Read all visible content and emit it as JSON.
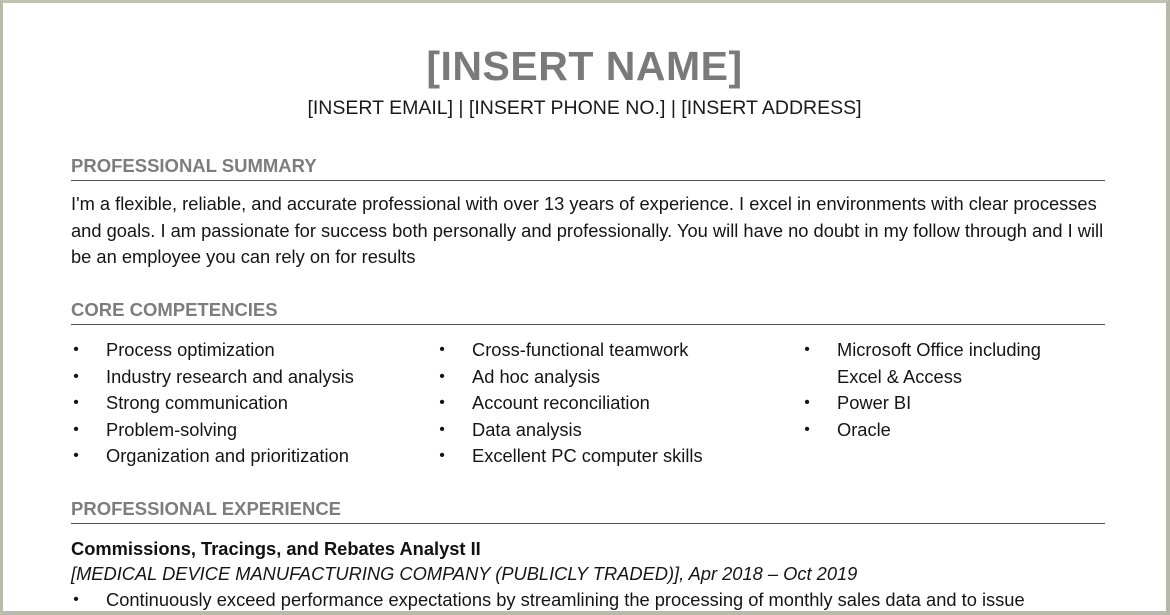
{
  "header": {
    "name": "[INSERT NAME]",
    "contact": "[INSERT EMAIL] | [INSERT PHONE NO.] | [INSERT ADDRESS]"
  },
  "colors": {
    "heading_gray": "#7d7d7d",
    "rule": "#555555",
    "body_text": "#151515",
    "frame": "#b8bcaa"
  },
  "summary": {
    "heading": "PROFESSIONAL SUMMARY",
    "text": "I'm a flexible, reliable, and accurate professional with over 13 years of experience. I excel in environments with clear processes and goals. I am passionate for success both personally and professionally. You will have no doubt in my follow through and I will be an employee you can rely on for results"
  },
  "competencies": {
    "heading": "CORE COMPETENCIES",
    "bullet_glyph": "•",
    "columns": [
      [
        "Process optimization",
        "Industry research and analysis",
        "Strong communication",
        "Problem-solving",
        "Organization and prioritization"
      ],
      [
        "Cross-functional teamwork",
        "Ad hoc analysis",
        "Account reconciliation",
        "Data analysis",
        "Excellent PC computer skills"
      ],
      [
        "Microsoft Office including Excel & Access",
        "Power BI",
        "Oracle"
      ]
    ]
  },
  "experience": {
    "heading": "PROFESSIONAL EXPERIENCE",
    "jobs": [
      {
        "title": "Commissions, Tracings, and Rebates Analyst II",
        "company_dates": "[MEDICAL DEVICE MANUFACTURING COMPANY (PUBLICLY TRADED)], Apr 2018 – Oct 2019",
        "bullets": [
          "Continuously exceed performance expectations by streamlining the processing of monthly sales data and to issue"
        ]
      }
    ]
  }
}
